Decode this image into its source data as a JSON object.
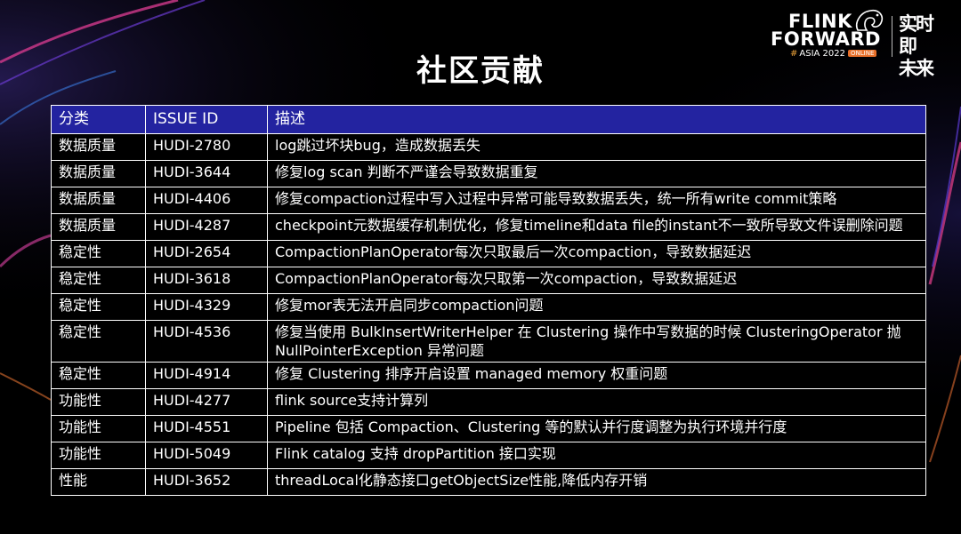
{
  "brand": {
    "logo_line1": "FLINK",
    "logo_line2": "FORWARD",
    "logo_line3_hash": "#",
    "logo_line3": "ASIA 2022",
    "logo_tag": "ONLINE",
    "slogan_line1": "实时即",
    "slogan_line2": "未来",
    "accent_color": "#e8702a"
  },
  "title": "社区贡献",
  "table": {
    "headers": [
      "分类",
      "ISSUE ID",
      "描述"
    ],
    "header_color": "#2323a0",
    "rows": [
      {
        "category": "数据质量",
        "issue": "HUDI-2780",
        "desc": "log跳过坏块bug，造成数据丢失"
      },
      {
        "category": "数据质量",
        "issue": "HUDI-3644",
        "desc": "修复log scan 判断不严谨会导致数据重复"
      },
      {
        "category": "数据质量",
        "issue": "HUDI-4406",
        "desc": "修复compaction过程中写入过程中异常可能导致数据丢失，统一所有write commit策略"
      },
      {
        "category": "数据质量",
        "issue": "HUDI-4287",
        "desc": "checkpoint元数据缓存机制优化，修复timeline和data file的instant不一致所导致文件误删除问题"
      },
      {
        "category": "稳定性",
        "issue": "HUDI-2654",
        "desc": "CompactionPlanOperator每次只取最后一次compaction，导致数据延迟"
      },
      {
        "category": "稳定性",
        "issue": "HUDI-3618",
        "desc": "CompactionPlanOperator每次只取第一次compaction，导致数据延迟"
      },
      {
        "category": "稳定性",
        "issue": "HUDI-4329",
        "desc": "修复mor表无法开启同步compaction问题"
      },
      {
        "category": "稳定性",
        "issue": "HUDI-4536",
        "desc": "修复当使用 BulkInsertWriterHelper 在 Clustering 操作中写数据的时候 ClusteringOperator 抛 NullPointerException 异常问题"
      },
      {
        "category": "稳定性",
        "issue": "HUDI-4914",
        "desc": "修复 Clustering 排序开启设置 managed memory 权重问题"
      },
      {
        "category": "功能性",
        "issue": "HUDI-4277",
        "desc": "flink source支持计算列"
      },
      {
        "category": "功能性",
        "issue": "HUDI-4551",
        "desc": "Pipeline 包括 Compaction、Clustering 等的默认并行度调整为执行环境并行度"
      },
      {
        "category": "功能性",
        "issue": "HUDI-5049",
        "desc": "Flink catalog 支持 dropPartition 接口实现"
      },
      {
        "category": "性能",
        "issue": "HUDI-3652",
        "desc": "threadLocal化静态接口getObjectSize性能,降低内存开销"
      }
    ]
  }
}
